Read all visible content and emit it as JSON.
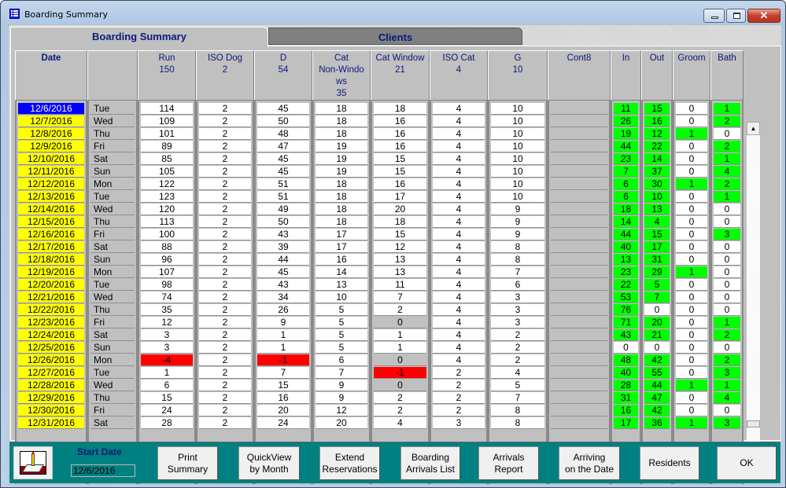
{
  "window": {
    "title": "Boarding Summary",
    "controls": {
      "minimize": "minimize",
      "maximize": "maximize",
      "close": "✕"
    }
  },
  "tabs": [
    {
      "label": "Boarding Summary",
      "active": true
    },
    {
      "label": "Clients",
      "active": false
    }
  ],
  "columns": [
    {
      "key": "date",
      "label": "Date"
    },
    {
      "key": "day",
      "label": ""
    },
    {
      "key": "run",
      "label": "Run\n150"
    },
    {
      "key": "iso_dog",
      "label": "ISO Dog\n2"
    },
    {
      "key": "d",
      "label": "D\n54"
    },
    {
      "key": "cat_nw",
      "label": "Cat\nNon-Windo\nws\n35"
    },
    {
      "key": "cat_win",
      "label": "Cat Window\n21"
    },
    {
      "key": "iso_cat",
      "label": "ISO Cat\n4"
    },
    {
      "key": "g",
      "label": "G\n10"
    },
    {
      "key": "cont8",
      "label": "Cont8"
    },
    {
      "key": "in",
      "label": "In"
    },
    {
      "key": "out",
      "label": "Out"
    },
    {
      "key": "groom",
      "label": "Groom"
    },
    {
      "key": "bath",
      "label": "Bath"
    }
  ],
  "rows": [
    {
      "date": "12/6/2016",
      "day": "Tue",
      "run": "114",
      "iso_dog": "2",
      "d": "45",
      "cat_nw": "18",
      "cat_win": "18",
      "iso_cat": "4",
      "g": "10",
      "in": "11",
      "out": "15",
      "groom": "0",
      "bath": "1",
      "selected": true
    },
    {
      "date": "12/7/2016",
      "day": "Wed",
      "run": "109",
      "iso_dog": "2",
      "d": "50",
      "cat_nw": "18",
      "cat_win": "16",
      "iso_cat": "4",
      "g": "10",
      "in": "26",
      "out": "16",
      "groom": "0",
      "bath": "2"
    },
    {
      "date": "12/8/2016",
      "day": "Thu",
      "run": "101",
      "iso_dog": "2",
      "d": "48",
      "cat_nw": "18",
      "cat_win": "16",
      "iso_cat": "4",
      "g": "10",
      "in": "19",
      "out": "12",
      "groom": "1",
      "bath": "0"
    },
    {
      "date": "12/9/2016",
      "day": "Fri",
      "run": "89",
      "iso_dog": "2",
      "d": "47",
      "cat_nw": "19",
      "cat_win": "16",
      "iso_cat": "4",
      "g": "10",
      "in": "44",
      "out": "22",
      "groom": "0",
      "bath": "2"
    },
    {
      "date": "12/10/2016",
      "day": "Sat",
      "run": "85",
      "iso_dog": "2",
      "d": "45",
      "cat_nw": "19",
      "cat_win": "15",
      "iso_cat": "4",
      "g": "10",
      "in": "23",
      "out": "14",
      "groom": "0",
      "bath": "1"
    },
    {
      "date": "12/11/2016",
      "day": "Sun",
      "run": "105",
      "iso_dog": "2",
      "d": "45",
      "cat_nw": "19",
      "cat_win": "15",
      "iso_cat": "4",
      "g": "10",
      "in": "7",
      "out": "37",
      "groom": "0",
      "bath": "4"
    },
    {
      "date": "12/12/2016",
      "day": "Mon",
      "run": "122",
      "iso_dog": "2",
      "d": "51",
      "cat_nw": "18",
      "cat_win": "16",
      "iso_cat": "4",
      "g": "10",
      "in": "6",
      "out": "30",
      "groom": "1",
      "bath": "2"
    },
    {
      "date": "12/13/2016",
      "day": "Tue",
      "run": "123",
      "iso_dog": "2",
      "d": "51",
      "cat_nw": "18",
      "cat_win": "17",
      "iso_cat": "4",
      "g": "10",
      "in": "6",
      "out": "10",
      "groom": "0",
      "bath": "1"
    },
    {
      "date": "12/14/2016",
      "day": "Wed",
      "run": "120",
      "iso_dog": "2",
      "d": "49",
      "cat_nw": "18",
      "cat_win": "20",
      "iso_cat": "4",
      "g": "9",
      "in": "18",
      "out": "13",
      "groom": "0",
      "bath": "0"
    },
    {
      "date": "12/15/2016",
      "day": "Thu",
      "run": "113",
      "iso_dog": "2",
      "d": "50",
      "cat_nw": "18",
      "cat_win": "18",
      "iso_cat": "4",
      "g": "9",
      "in": "14",
      "out": "4",
      "groom": "0",
      "bath": "0"
    },
    {
      "date": "12/16/2016",
      "day": "Fri",
      "run": "100",
      "iso_dog": "2",
      "d": "43",
      "cat_nw": "17",
      "cat_win": "15",
      "iso_cat": "4",
      "g": "9",
      "in": "44",
      "out": "15",
      "groom": "0",
      "bath": "3"
    },
    {
      "date": "12/17/2016",
      "day": "Sat",
      "run": "88",
      "iso_dog": "2",
      "d": "39",
      "cat_nw": "17",
      "cat_win": "12",
      "iso_cat": "4",
      "g": "8",
      "in": "40",
      "out": "17",
      "groom": "0",
      "bath": "0"
    },
    {
      "date": "12/18/2016",
      "day": "Sun",
      "run": "96",
      "iso_dog": "2",
      "d": "44",
      "cat_nw": "16",
      "cat_win": "13",
      "iso_cat": "4",
      "g": "8",
      "in": "13",
      "out": "31",
      "groom": "0",
      "bath": "0"
    },
    {
      "date": "12/19/2016",
      "day": "Mon",
      "run": "107",
      "iso_dog": "2",
      "d": "45",
      "cat_nw": "14",
      "cat_win": "13",
      "iso_cat": "4",
      "g": "7",
      "in": "23",
      "out": "29",
      "groom": "1",
      "bath": "0"
    },
    {
      "date": "12/20/2016",
      "day": "Tue",
      "run": "98",
      "iso_dog": "2",
      "d": "43",
      "cat_nw": "13",
      "cat_win": "11",
      "iso_cat": "4",
      "g": "6",
      "in": "22",
      "out": "5",
      "groom": "0",
      "bath": "0"
    },
    {
      "date": "12/21/2016",
      "day": "Wed",
      "run": "74",
      "iso_dog": "2",
      "d": "34",
      "cat_nw": "10",
      "cat_win": "7",
      "iso_cat": "4",
      "g": "3",
      "in": "53",
      "out": "7",
      "groom": "0",
      "bath": "0"
    },
    {
      "date": "12/22/2016",
      "day": "Thu",
      "run": "35",
      "iso_dog": "2",
      "d": "26",
      "cat_nw": "5",
      "cat_win": "2",
      "iso_cat": "4",
      "g": "3",
      "in": "76",
      "out": "0",
      "groom": "0",
      "bath": "0"
    },
    {
      "date": "12/23/2016",
      "day": "Fri",
      "run": "12",
      "iso_dog": "2",
      "d": "9",
      "cat_nw": "5",
      "cat_win": "0",
      "iso_cat": "4",
      "g": "3",
      "in": "71",
      "out": "20",
      "groom": "0",
      "bath": "1"
    },
    {
      "date": "12/24/2016",
      "day": "Sat",
      "run": "3",
      "iso_dog": "2",
      "d": "1",
      "cat_nw": "5",
      "cat_win": "1",
      "iso_cat": "4",
      "g": "2",
      "in": "43",
      "out": "21",
      "groom": "0",
      "bath": "2"
    },
    {
      "date": "12/25/2016",
      "day": "Sun",
      "run": "3",
      "iso_dog": "2",
      "d": "1",
      "cat_nw": "5",
      "cat_win": "1",
      "iso_cat": "4",
      "g": "2",
      "in": "0",
      "out": "0",
      "groom": "0",
      "bath": "0"
    },
    {
      "date": "12/26/2016",
      "day": "Mon",
      "run": "-4",
      "iso_dog": "2",
      "d": "-1",
      "cat_nw": "6",
      "cat_win": "0",
      "iso_cat": "4",
      "g": "2",
      "in": "48",
      "out": "42",
      "groom": "0",
      "bath": "2"
    },
    {
      "date": "12/27/2016",
      "day": "Tue",
      "run": "1",
      "iso_dog": "2",
      "d": "7",
      "cat_nw": "7",
      "cat_win": "-1",
      "iso_cat": "2",
      "g": "4",
      "in": "40",
      "out": "55",
      "groom": "0",
      "bath": "3"
    },
    {
      "date": "12/28/2016",
      "day": "Wed",
      "run": "6",
      "iso_dog": "2",
      "d": "15",
      "cat_nw": "9",
      "cat_win": "0",
      "iso_cat": "2",
      "g": "5",
      "in": "28",
      "out": "44",
      "groom": "1",
      "bath": "1"
    },
    {
      "date": "12/29/2016",
      "day": "Thu",
      "run": "15",
      "iso_dog": "2",
      "d": "16",
      "cat_nw": "9",
      "cat_win": "2",
      "iso_cat": "2",
      "g": "7",
      "in": "31",
      "out": "47",
      "groom": "0",
      "bath": "4"
    },
    {
      "date": "12/30/2016",
      "day": "Fri",
      "run": "24",
      "iso_dog": "2",
      "d": "20",
      "cat_nw": "12",
      "cat_win": "2",
      "iso_cat": "2",
      "g": "8",
      "in": "16",
      "out": "42",
      "groom": "0",
      "bath": "0"
    },
    {
      "date": "12/31/2016",
      "day": "Sat",
      "run": "28",
      "iso_dog": "2",
      "d": "24",
      "cat_nw": "20",
      "cat_win": "4",
      "iso_cat": "3",
      "g": "8",
      "in": "17",
      "out": "36",
      "groom": "1",
      "bath": "3"
    }
  ],
  "colors": {
    "selected_date": "#0000ff",
    "date": "#ffff00",
    "positive_activity": "#00ff00",
    "negative": "#ff0000",
    "zero_capacity": "#c0c0c0",
    "toolbar": "#008080",
    "header_text": "#0a1a78"
  },
  "scrollbar": {
    "up": "▲",
    "down": "▼"
  },
  "toolbar": {
    "start_date_label": "Start Date",
    "start_date_value": "12/6/2016",
    "buttons": [
      {
        "name": "print-summary-button",
        "label": "Print\nSummary"
      },
      {
        "name": "quickview-by-month-button",
        "label": "QuickView\nby Month"
      },
      {
        "name": "extend-reservations-button",
        "label": "Extend\nReservations"
      },
      {
        "name": "boarding-arrivals-list-button",
        "label": "Boarding\nArrivals List"
      },
      {
        "name": "arrivals-report-button",
        "label": "Arrivals\nReport"
      },
      {
        "name": "arriving-on-the-date-button",
        "label": "Arriving\non the Date"
      },
      {
        "name": "residents-button",
        "label": "Residents"
      },
      {
        "name": "ok-button",
        "label": "OK"
      }
    ]
  }
}
